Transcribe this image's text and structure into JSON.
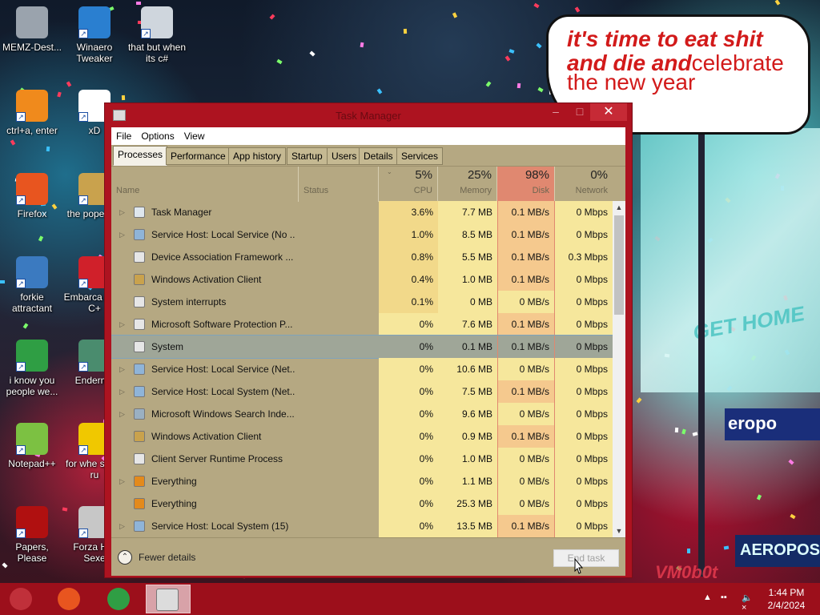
{
  "desktop_icons": [
    {
      "label": "MEMZ-Dest...",
      "icon": "recycle-bin-icon",
      "color": "#9aa3ad"
    },
    {
      "label": "Winaero Tweaker",
      "icon": "winaero-icon",
      "color": "#2a7fd0"
    },
    {
      "label": "that but when its c#",
      "icon": "folder-stack-icon",
      "color": "#cfd6dd"
    },
    {
      "label": "ctrl+a, enter",
      "icon": "ring-icon",
      "color": "#f08a1c"
    },
    {
      "label": "xD",
      "icon": "hxd-icon",
      "color": "#ffffff"
    },
    {
      "label": "Firefox",
      "icon": "firefox-icon",
      "color": "#e8551f"
    },
    {
      "label": "the pope shit",
      "icon": "image-icon",
      "color": "#c9a24d"
    },
    {
      "label": "forkie attractant",
      "icon": "gear-monitor-icon",
      "color": "#3b7ac0"
    },
    {
      "label": "Embarca Dev-C+",
      "icon": "devcpp-icon",
      "color": "#d0202a"
    },
    {
      "label": "i know you people we...",
      "icon": "chrome-icon",
      "color": "#2f9e44"
    },
    {
      "label": "Enderma",
      "icon": "terminal-icon",
      "color": "#4a8c6e"
    },
    {
      "label": "Notepad++",
      "icon": "notepadpp-icon",
      "color": "#7cc142"
    },
    {
      "label": "for whe some ru",
      "icon": "dic-icon",
      "color": "#f0c800"
    },
    {
      "label": "Papers, Please",
      "icon": "papers-please-icon",
      "color": "#b01010"
    },
    {
      "label": "Forza Hor Sexe",
      "icon": "flash-icon",
      "color": "#c7c7c7"
    }
  ],
  "speech_bubble": {
    "line1": "it's time to eat shit",
    "line2": "and die and",
    "line3": "celebrate",
    "line4": "the new year"
  },
  "wallpaper": {
    "sign_text": "GET HOME",
    "neon_text": "eropo",
    "neon2_text": "AEROPOS",
    "watermark": "VM0b0t"
  },
  "window": {
    "title": "Task Manager",
    "menu": [
      "File",
      "Options",
      "View"
    ],
    "tabs": [
      "Processes",
      "Performance",
      "App history",
      "Startup",
      "Users",
      "Details",
      "Services"
    ],
    "active_tab": "Processes",
    "columns": {
      "name": "Name",
      "status": "Status",
      "cpu": {
        "pct": "5%",
        "label": "CPU"
      },
      "memory": {
        "pct": "25%",
        "label": "Memory"
      },
      "disk": {
        "pct": "98%",
        "label": "Disk"
      },
      "network": {
        "pct": "0%",
        "label": "Network"
      }
    },
    "processes": [
      {
        "name": "Task Manager",
        "expandable": true,
        "icon": "task-manager-icon",
        "cpu": "3.6%",
        "memory": "7.7 MB",
        "disk": "0.1 MB/s",
        "network": "0 Mbps"
      },
      {
        "name": "Service Host: Local Service (No ...",
        "expandable": true,
        "icon": "gear-icon",
        "cpu": "1.0%",
        "memory": "8.5 MB",
        "disk": "0.1 MB/s",
        "network": "0 Mbps"
      },
      {
        "name": "Device Association Framework ...",
        "expandable": false,
        "icon": "window-icon",
        "cpu": "0.8%",
        "memory": "5.5 MB",
        "disk": "0.1 MB/s",
        "network": "0.3 Mbps"
      },
      {
        "name": "Windows Activation Client",
        "expandable": false,
        "icon": "key-icon",
        "cpu": "0.4%",
        "memory": "1.0 MB",
        "disk": "0.1 MB/s",
        "network": "0 Mbps"
      },
      {
        "name": "System interrupts",
        "expandable": false,
        "icon": "window-icon",
        "cpu": "0.1%",
        "memory": "0 MB",
        "disk": "0 MB/s",
        "network": "0 Mbps"
      },
      {
        "name": "Microsoft Software Protection P...",
        "expandable": true,
        "icon": "window-icon",
        "cpu": "0%",
        "memory": "7.6 MB",
        "disk": "0.1 MB/s",
        "network": "0 Mbps"
      },
      {
        "name": "System",
        "expandable": false,
        "icon": "window-icon",
        "cpu": "0%",
        "memory": "0.1 MB",
        "disk": "0.1 MB/s",
        "network": "0 Mbps",
        "selected": true
      },
      {
        "name": "Service Host: Local Service (Net...",
        "expandable": true,
        "icon": "gear-icon",
        "cpu": "0%",
        "memory": "10.6 MB",
        "disk": "0 MB/s",
        "network": "0 Mbps"
      },
      {
        "name": "Service Host: Local System (Net...",
        "expandable": true,
        "icon": "gear-icon",
        "cpu": "0%",
        "memory": "7.5 MB",
        "disk": "0.1 MB/s",
        "network": "0 Mbps"
      },
      {
        "name": "Microsoft Windows Search Inde...",
        "expandable": true,
        "icon": "search-user-icon",
        "cpu": "0%",
        "memory": "9.6 MB",
        "disk": "0 MB/s",
        "network": "0 Mbps"
      },
      {
        "name": "Windows Activation Client",
        "expandable": false,
        "icon": "key-icon",
        "cpu": "0%",
        "memory": "0.9 MB",
        "disk": "0.1 MB/s",
        "network": "0 Mbps"
      },
      {
        "name": "Client Server Runtime Process",
        "expandable": false,
        "icon": "window-icon",
        "cpu": "0%",
        "memory": "1.0 MB",
        "disk": "0 MB/s",
        "network": "0 Mbps"
      },
      {
        "name": "Everything",
        "expandable": true,
        "icon": "magnifier-icon",
        "cpu": "0%",
        "memory": "1.1 MB",
        "disk": "0 MB/s",
        "network": "0 Mbps"
      },
      {
        "name": "Everything",
        "expandable": false,
        "icon": "magnifier-icon",
        "cpu": "0%",
        "memory": "25.3 MB",
        "disk": "0 MB/s",
        "network": "0 Mbps"
      },
      {
        "name": "Service Host: Local System (15)",
        "expandable": true,
        "icon": "gear-icon",
        "cpu": "0%",
        "memory": "13.5 MB",
        "disk": "0.1 MB/s",
        "network": "0 Mbps"
      }
    ],
    "fewer_details": "Fewer details",
    "end_task": "End task"
  },
  "taskbar": {
    "buttons": [
      {
        "name": "start-button",
        "icon": "start-orb-icon",
        "color": "#c0303a"
      },
      {
        "name": "taskbar-firefox",
        "icon": "firefox-icon",
        "color": "#e8551f"
      },
      {
        "name": "taskbar-chrome",
        "icon": "chrome-icon",
        "color": "#2f9e44"
      },
      {
        "name": "taskbar-task-manager",
        "icon": "task-manager-icon",
        "color": "#dcdcdc"
      }
    ],
    "time": "1:44 PM",
    "date": "2/4/2024"
  },
  "colors": {
    "window_frame": "#ad1320",
    "content_bg": "#b5a882",
    "disk_header": "#e08870",
    "heat_1": "#f6e79c",
    "heat_2": "#f2d98a",
    "heat_disk": "#f5c98e",
    "taskbar": "#9c0f1b"
  }
}
